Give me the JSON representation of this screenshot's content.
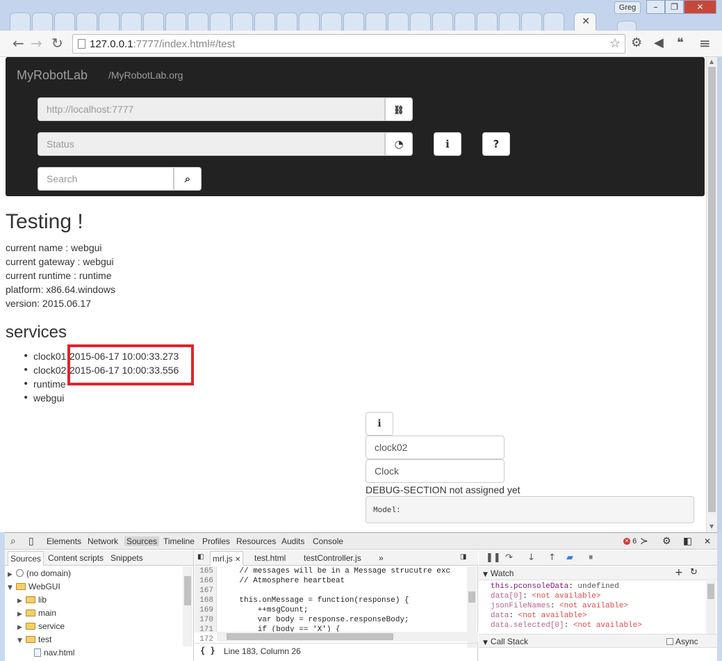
{
  "window": {
    "user": "Greg",
    "controls": [
      "–",
      "❐",
      "✕"
    ]
  },
  "tab": {
    "close_icon": "✕"
  },
  "toolbar": {
    "back": "←",
    "forward": "→",
    "reload": "↻",
    "url_host": "127.0.0.1",
    "url_rest": ":7777/index.html#/test",
    "star": "☆",
    "icons": {
      "extension": "⚙",
      "cast": "◀",
      "hangouts": "❝",
      "menu": "≡"
    }
  },
  "navbar": {
    "brand": "MyRobotLab",
    "link": "/MyRobotLab.org",
    "connect_placeholder": "http://localhost:7777",
    "status_placeholder": "Status",
    "search_placeholder": "Search",
    "icons": {
      "link": "🔗",
      "dashboard": "◔",
      "info": "ℹ",
      "help": "?",
      "search": "⌕"
    }
  },
  "page": {
    "title": "Testing !",
    "info_lines": [
      "current name : webgui",
      "current gateway : webgui",
      "current runtime : runtime",
      "platform: x86.64.windows",
      "version: 2015.06.17"
    ],
    "services_heading": "services",
    "services": [
      {
        "name": "clock01",
        "time": "2015-06-17 10:00:33.273"
      },
      {
        "name": "clock02",
        "time": "2015-06-17 10:00:33.556"
      },
      {
        "name": "runtime",
        "time": ""
      },
      {
        "name": "webgui",
        "time": ""
      }
    ],
    "info_button_icon": "ℹ",
    "selected_name": "clock02",
    "selected_type": "Clock",
    "debug_label": "DEBUG-SECTION not assigned yet",
    "model_label": "Model:"
  },
  "devtools": {
    "tabs": [
      "Elements",
      "Network",
      "Sources",
      "Timeline",
      "Profiles",
      "Resources",
      "Audits",
      "Console"
    ],
    "active_tab": "Sources",
    "error_count": "6",
    "navigator_tabs": [
      "Sources",
      "Content scripts",
      "Snippets"
    ],
    "tree": [
      {
        "label": "(no domain)",
        "kind": "globe",
        "depth": 0,
        "toggle": "▶"
      },
      {
        "label": "WebGUI",
        "kind": "folder",
        "depth": 0,
        "toggle": "▼"
      },
      {
        "label": "lib",
        "kind": "folder",
        "depth": 1,
        "toggle": "▶"
      },
      {
        "label": "main",
        "kind": "folder",
        "depth": 1,
        "toggle": "▶"
      },
      {
        "label": "service",
        "kind": "folder",
        "depth": 1,
        "toggle": "▶"
      },
      {
        "label": "test",
        "kind": "folder",
        "depth": 1,
        "toggle": "▼"
      },
      {
        "label": "nav.html",
        "kind": "file",
        "depth": 2,
        "toggle": ""
      }
    ],
    "editor_tabs": [
      {
        "label": "mrl.js",
        "active": true
      },
      {
        "label": "test.html",
        "active": false
      },
      {
        "label": "testController.js",
        "active": false
      }
    ],
    "editor_more": "»",
    "code_lines": [
      {
        "num": "165",
        "text": "    // messages will be in a Message strucutre exc"
      },
      {
        "num": "166",
        "text": "    // Atmosphere heartbeat"
      },
      {
        "num": "167",
        "text": ""
      },
      {
        "num": "168",
        "text": "    this.onMessage = function(response) {"
      },
      {
        "num": "169",
        "text": "        ++msgCount;"
      },
      {
        "num": "170",
        "text": "        var body = response.responseBody;"
      },
      {
        "num": "171",
        "text": "        if (body == 'X') {"
      },
      {
        "num": "172",
        "text": ""
      }
    ],
    "status_braces": "{ }",
    "cursor_pos": "Line 183, Column 26",
    "watch_title": "Watch",
    "watch": [
      {
        "expr": "this.pconsoleData",
        "sep": ": ",
        "val": "undefined",
        "na": false
      },
      {
        "expr": "data[0]",
        "sep": ": ",
        "val": "<not available>",
        "na": true
      },
      {
        "expr": "jsonFileNames",
        "sep": ": ",
        "val": "<not available>",
        "na": true
      },
      {
        "expr": "data",
        "sep": ": ",
        "val": "<not available>",
        "na": true
      },
      {
        "expr": "data.selected[0]",
        "sep": ": ",
        "val": "<not available>",
        "na": true
      }
    ],
    "call_stack_title": "Call Stack",
    "async_label": "Async"
  }
}
